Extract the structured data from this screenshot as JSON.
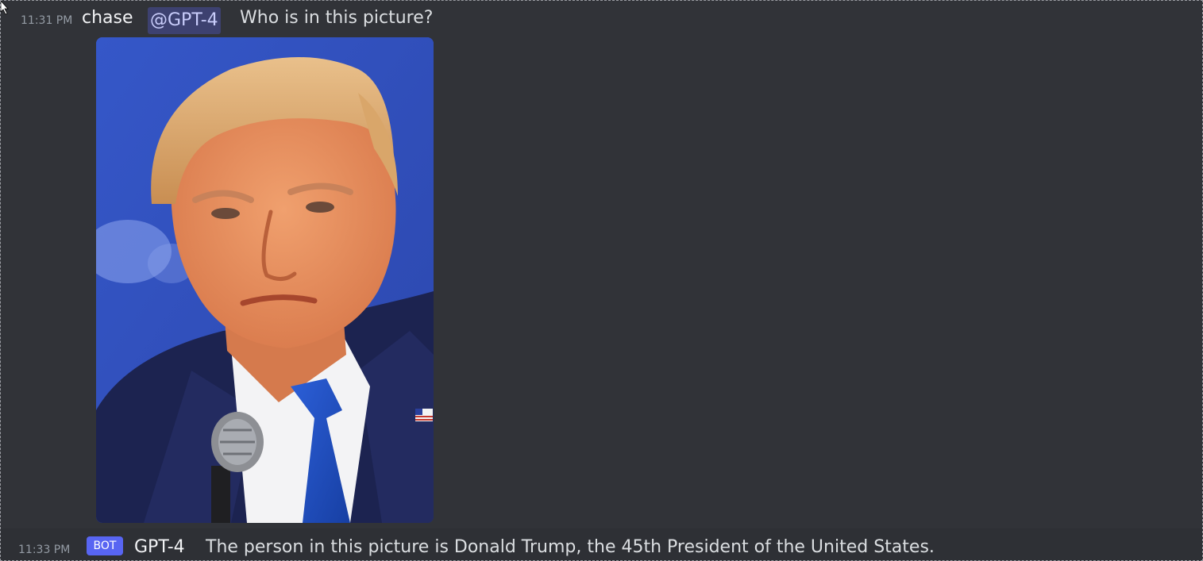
{
  "messages": [
    {
      "timestamp": "11:31 PM",
      "author": "chase",
      "mention": "@GPT-4",
      "text": "Who is in this picture?",
      "attachment": {
        "type": "image",
        "description_icon": "portrait-photo"
      }
    },
    {
      "timestamp": "11:33 PM",
      "badge": "BOT",
      "author": "GPT-4",
      "text": "The person in this picture is Donald Trump, the 45th President of the United States."
    }
  ],
  "colors": {
    "background": "#313338",
    "hover_background": "#2e3035",
    "mention_text": "#c9cdfb",
    "bot_badge": "#5865f2",
    "timestamp": "#949ba4"
  }
}
